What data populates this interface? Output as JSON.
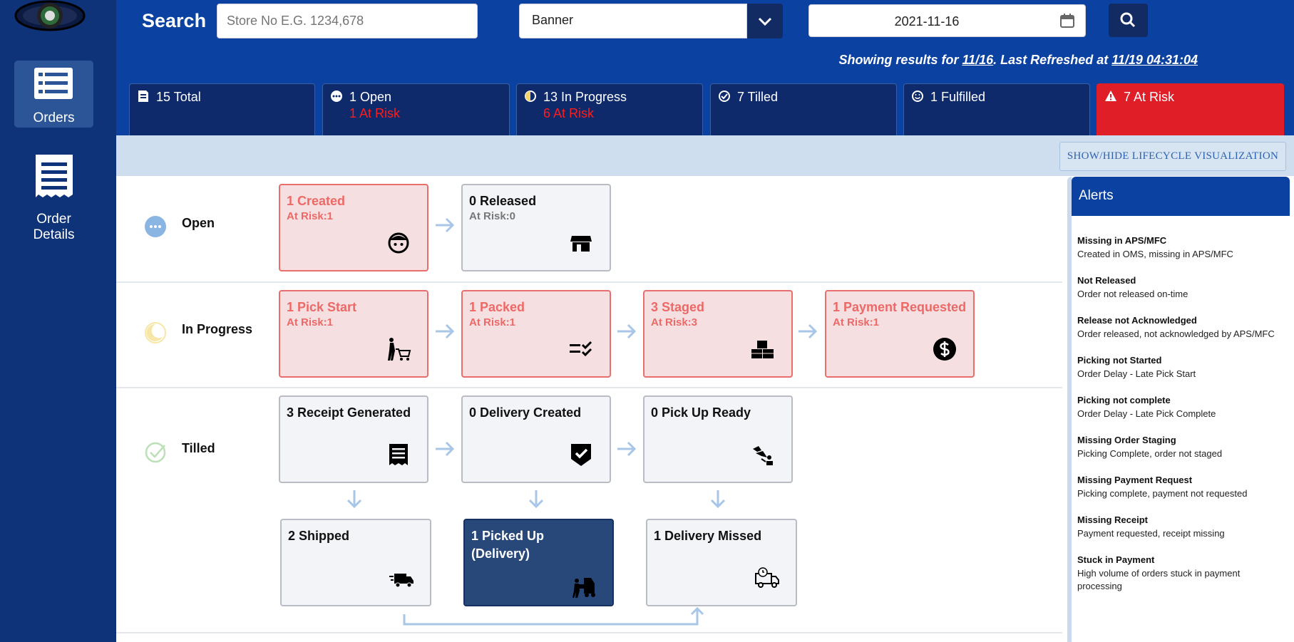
{
  "sidebar": {
    "items": [
      {
        "label": "Orders",
        "icon": "list-icon",
        "active": true
      },
      {
        "label": "Order Details",
        "icon": "receipt-icon",
        "active": false
      }
    ]
  },
  "search": {
    "title": "Search",
    "store_placeholder": "Store No E.G. 1234,678",
    "banner_value": "Banner",
    "date_value": "2021-11-16"
  },
  "status": {
    "prefix": "Showing results for ",
    "date": "11/16",
    "middle": ". Last Refreshed at ",
    "refreshed": "11/19 04:31:04"
  },
  "summary_cards": [
    {
      "label": "15 Total",
      "risk": "",
      "icon": "document-icon"
    },
    {
      "label": "1 Open",
      "risk": "1 At Risk",
      "icon": "dots-icon"
    },
    {
      "label": "13 In Progress",
      "risk": "6 At Risk",
      "icon": "half-moon-icon"
    },
    {
      "label": "7 Tilled",
      "risk": "",
      "icon": "check-circle-icon"
    },
    {
      "label": "1 Fulfilled",
      "risk": "",
      "icon": "smile-icon"
    },
    {
      "label": "7 At Risk",
      "risk": "",
      "icon": "warning-icon"
    }
  ],
  "lifecycle_toggle": "SHOW/HIDE LIFECYCLE VISUALIZATION",
  "stages": {
    "open": {
      "label": "Open"
    },
    "in_progress": {
      "label": "In Progress"
    },
    "tilled": {
      "label": "Tilled"
    }
  },
  "boxes": {
    "created": {
      "title": "1 Created",
      "sub": "At Risk:1"
    },
    "released": {
      "title": "0 Released",
      "sub": "At Risk:0"
    },
    "pick_start": {
      "title": "1 Pick Start",
      "sub": "At Risk:1"
    },
    "packed": {
      "title": "1 Packed",
      "sub": "At Risk:1"
    },
    "staged": {
      "title": "3 Staged",
      "sub": "At Risk:3"
    },
    "payment_requested": {
      "title": "1 Payment Requested",
      "sub": "At Risk:1"
    },
    "receipt_generated": {
      "title": "3 Receipt Generated"
    },
    "delivery_created": {
      "title": "0 Delivery Created"
    },
    "pickup_ready": {
      "title": "0 Pick Up Ready"
    },
    "shipped": {
      "title": "2 Shipped"
    },
    "picked_up": {
      "title": "1 Picked Up (Delivery)"
    },
    "delivery_missed": {
      "title": "1 Delivery Missed"
    }
  },
  "alerts": {
    "title": "Alerts",
    "items": [
      {
        "title": "Missing in APS/MFC",
        "desc": "Created in OMS, missing in APS/MFC"
      },
      {
        "title": "Not Released",
        "desc": "Order not released on-time"
      },
      {
        "title": "Release not Acknowledged",
        "desc": "Order released, not acknowledged by APS/MFC"
      },
      {
        "title": "Picking not Started",
        "desc": "Order Delay - Late Pick Start"
      },
      {
        "title": "Picking not complete",
        "desc": "Order Delay - Late Pick Complete"
      },
      {
        "title": "Missing Order Staging",
        "desc": "Picking Complete, order not staged"
      },
      {
        "title": "Missing Payment Request",
        "desc": "Picking complete, payment not requested"
      },
      {
        "title": "Missing Receipt",
        "desc": "Payment requested, receipt missing"
      },
      {
        "title": "Stuck in Payment",
        "desc": "High volume of orders stuck in payment processing"
      }
    ]
  },
  "colors": {
    "sidebar": "#0e3379",
    "header": "#0b41a0",
    "risk": "#e01e27",
    "risk_box": "#f5dfe0"
  }
}
